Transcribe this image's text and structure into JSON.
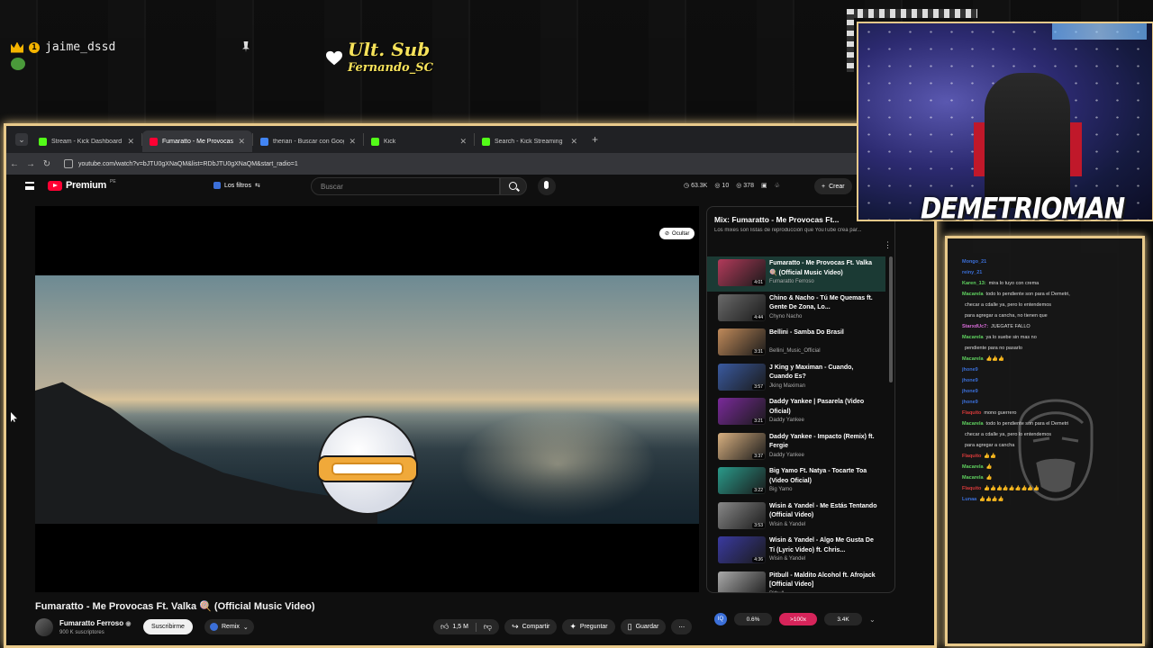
{
  "overlay": {
    "viewer_name": "jaime_dssd",
    "badge_count": "1",
    "last_sub_title": "Ult. Sub",
    "last_sub_name": "Fernando_SC",
    "streamer_name": "DEMETRIOMAN"
  },
  "browser": {
    "tabs": [
      {
        "label": "Stream - Kick Dashboard",
        "icon_color": "#53fc18",
        "active": false
      },
      {
        "label": "Fumaratto - Me Provocas F",
        "icon_color": "#ff0033",
        "active": true
      },
      {
        "label": "therian - Buscar con Google",
        "icon_color": "#4285f4",
        "active": false
      },
      {
        "label": "Kick",
        "icon_color": "#53fc18",
        "active": false
      },
      {
        "label": "Search - Kick Streaming",
        "icon_color": "#53fc18",
        "active": false
      }
    ],
    "url": "youtube.com/watch?v=bJTU0gXNaQM&list=RDbJTU0gXNaQM&start_radio=1"
  },
  "youtube": {
    "brand": "Premium",
    "brand_region": "PE",
    "filters_label": "Los filtros",
    "search_placeholder": "Buscar",
    "stats": [
      "63.3K",
      "10",
      "378"
    ],
    "create_label": "Crear",
    "hide_label": "Ocultar",
    "video_title": "Fumaratto - Me Provocas Ft. Valka 🍭 (Official Music Video)",
    "channel_name": "Fumaratto Ferroso",
    "channel_subs": "900 K suscriptores",
    "subscribe_label": "Suscribirme",
    "remix_label": "Remix",
    "likes": "1,5 M",
    "share_label": "Compartir",
    "ask_label": "Preguntar",
    "save_label": "Guardar"
  },
  "playlist": {
    "title": "Mix: Fumaratto - Me Provocas Ft...",
    "subtitle": "Los mixes son listas de reproducción que YouTube crea par...",
    "items": [
      {
        "title": "Fumaratto - Me Provocas Ft. Valka 🍭 (Official Music Video)",
        "artist": "Fumaratto Ferroso",
        "duration": "4:01",
        "thumb_color": "#b23a5a"
      },
      {
        "title": "Chino & Nacho - Tú Me Quemas ft. Gente De Zona, Lo...",
        "artist": "Chyno Nacho",
        "duration": "4:44",
        "thumb_color": "#6a6a6a"
      },
      {
        "title": "Bellini - Samba Do Brasil",
        "artist": "Bellini_Music_Official",
        "duration": "3:31",
        "thumb_color": "#c08a5a"
      },
      {
        "title": "J King y Maximan - Cuando, Cuando Es?",
        "artist": "Jking Maximan",
        "duration": "3:57",
        "thumb_color": "#3a5aa0"
      },
      {
        "title": "Daddy Yankee | Pasarela (Video Oficial)",
        "artist": "Daddy Yankee",
        "duration": "3:21",
        "thumb_color": "#7a2a9a"
      },
      {
        "title": "Daddy Yankee - Impacto (Remix) ft. Fergie",
        "artist": "Daddy Yankee",
        "duration": "3:37",
        "thumb_color": "#d8b080"
      },
      {
        "title": "Big Yamo Ft. Natya - Tocarte Toa (Video Oficial)",
        "artist": "Big Yamo",
        "duration": "3:22",
        "thumb_color": "#2a9a8a"
      },
      {
        "title": "Wisin & Yandel - Me Estás Tentando (Official Video)",
        "artist": "Wisin & Yandel",
        "duration": "3:53",
        "thumb_color": "#888888"
      },
      {
        "title": "Wisin & Yandel - Algo Me Gusta De Ti (Lyric Video) ft. Chris...",
        "artist": "Wisin & Yandel",
        "duration": "4:36",
        "thumb_color": "#3a3aa0"
      },
      {
        "title": "Pitbull - Maldito Alcohol ft. Afrojack [Official Video]",
        "artist": "Pitbull",
        "duration": "3:35",
        "thumb_color": "#aaaaaa"
      }
    ],
    "footer": {
      "stat1": "0.6%",
      "stat2": ">100x",
      "stat3": "3.4K"
    }
  },
  "chat": {
    "lines": [
      {
        "user": "Mongo_21",
        "color": "#3b6fd8",
        "text": ""
      },
      {
        "user": "reiny_21",
        "color": "#3b6fd8",
        "text": ""
      },
      {
        "user": "Karen_13:",
        "color": "#5fd35f",
        "text": "mira lo tuyo con crema"
      },
      {
        "user": "Macarela",
        "color": "#5fd35f",
        "text": "todo lo pendiente son para el Demetri,"
      },
      {
        "user": "",
        "color": "#ddd",
        "text": "checar a cdalle ya, pero lo entendemos"
      },
      {
        "user": "",
        "color": "#ddd",
        "text": "para agregar a cancha, no tienen que"
      },
      {
        "user": "StarxdUc7:",
        "color": "#d86cd8",
        "text": "JUEGATE FALLO"
      },
      {
        "user": "Macarela",
        "color": "#5fd35f",
        "text": "ya lo suebe sin mas no"
      },
      {
        "user": "",
        "color": "#ddd",
        "text": "pendiente para no pasarlo"
      },
      {
        "user": "Macarela",
        "color": "#5fd35f",
        "text": "👍👍👍"
      },
      {
        "user": "jhone9",
        "color": "#3b6fd8",
        "text": ""
      },
      {
        "user": "jhone9",
        "color": "#3b6fd8",
        "text": ""
      },
      {
        "user": "jhone9",
        "color": "#3b6fd8",
        "text": ""
      },
      {
        "user": "jhone9",
        "color": "#3b6fd8",
        "text": ""
      },
      {
        "user": "Flaquito",
        "color": "#d83a3a",
        "text": "mono guerrero"
      },
      {
        "user": "Macarela",
        "color": "#5fd35f",
        "text": "todo lo pendiente son para el Demetri"
      },
      {
        "user": "",
        "color": "#ddd",
        "text": "checar a cdalle ya, pero lo entendemos"
      },
      {
        "user": "",
        "color": "#ddd",
        "text": "para agregar a cancha"
      },
      {
        "user": "Flaquito",
        "color": "#d83a3a",
        "text": "👍👍"
      },
      {
        "user": "Macarela",
        "color": "#5fd35f",
        "text": "👍"
      },
      {
        "user": "Macarela",
        "color": "#5fd35f",
        "text": "👍"
      },
      {
        "user": "Flaquito",
        "color": "#d83a3a",
        "text": "👍👍👍👍👍👍👍👍👍"
      },
      {
        "user": "Lunaa",
        "color": "#3b6fd8",
        "text": "👍👍👍👍"
      }
    ]
  }
}
